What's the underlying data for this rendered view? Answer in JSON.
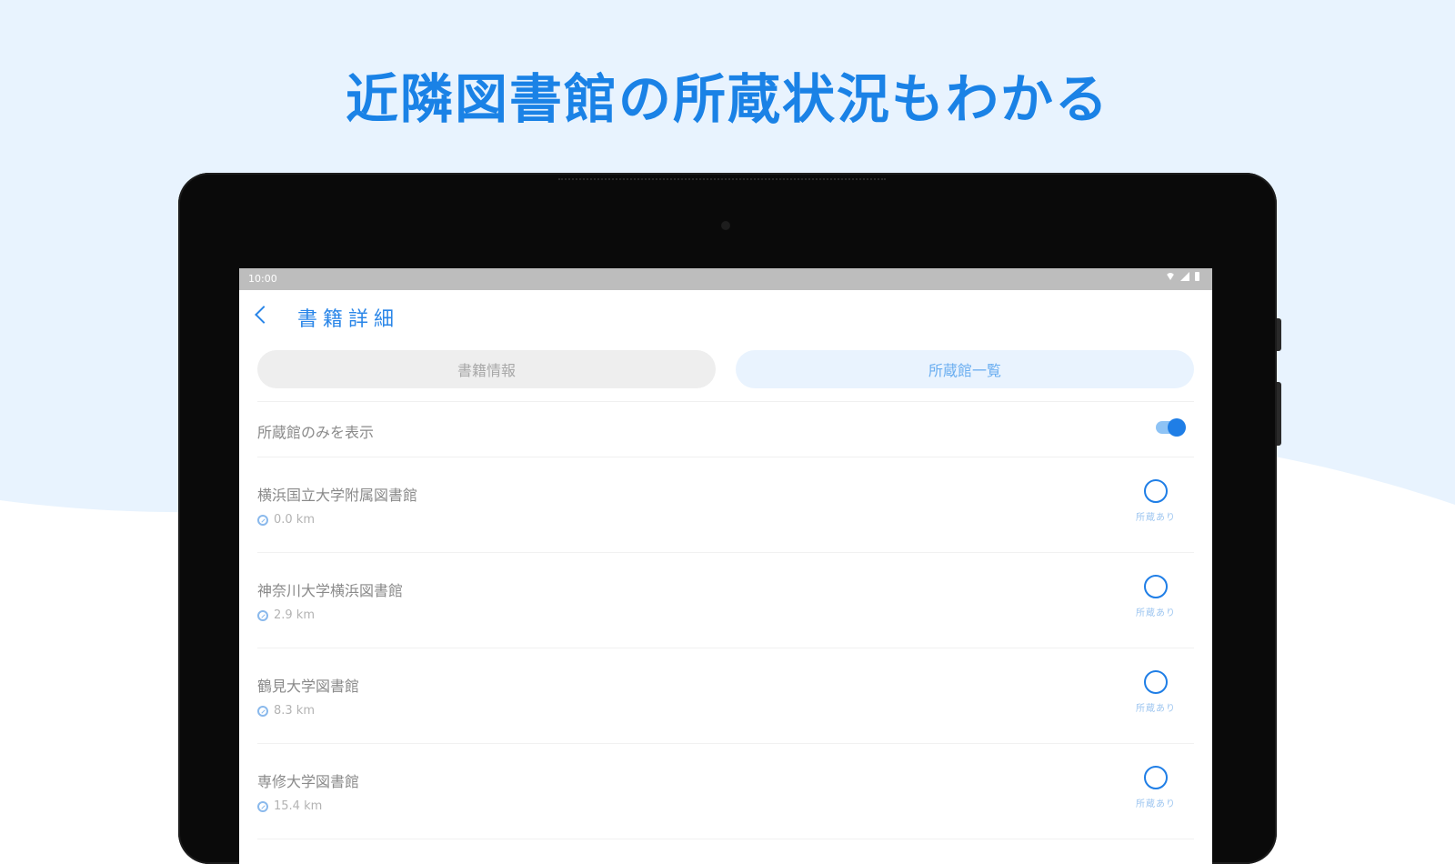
{
  "headline": "近隣図書館の所蔵状況もわかる",
  "colors": {
    "accent": "#1a82e6",
    "bg_light": "#e8f3fe"
  },
  "statusbar": {
    "time": "10:00"
  },
  "appbar": {
    "title": "書籍詳細",
    "back_icon": "chevron-left-icon"
  },
  "tabs": [
    {
      "label": "書籍情報",
      "active": false
    },
    {
      "label": "所蔵館一覧",
      "active": true
    }
  ],
  "filter": {
    "label": "所蔵館のみを表示",
    "enabled": true
  },
  "libraries": [
    {
      "name": "横浜国立大学附属図書館",
      "distance": "0.0 km",
      "status": "所蔵あり"
    },
    {
      "name": "神奈川大学横浜図書館",
      "distance": "2.9 km",
      "status": "所蔵あり"
    },
    {
      "name": "鶴見大学図書館",
      "distance": "8.3 km",
      "status": "所蔵あり"
    },
    {
      "name": "専修大学図書館",
      "distance": "15.4 km",
      "status": "所蔵あり"
    }
  ]
}
